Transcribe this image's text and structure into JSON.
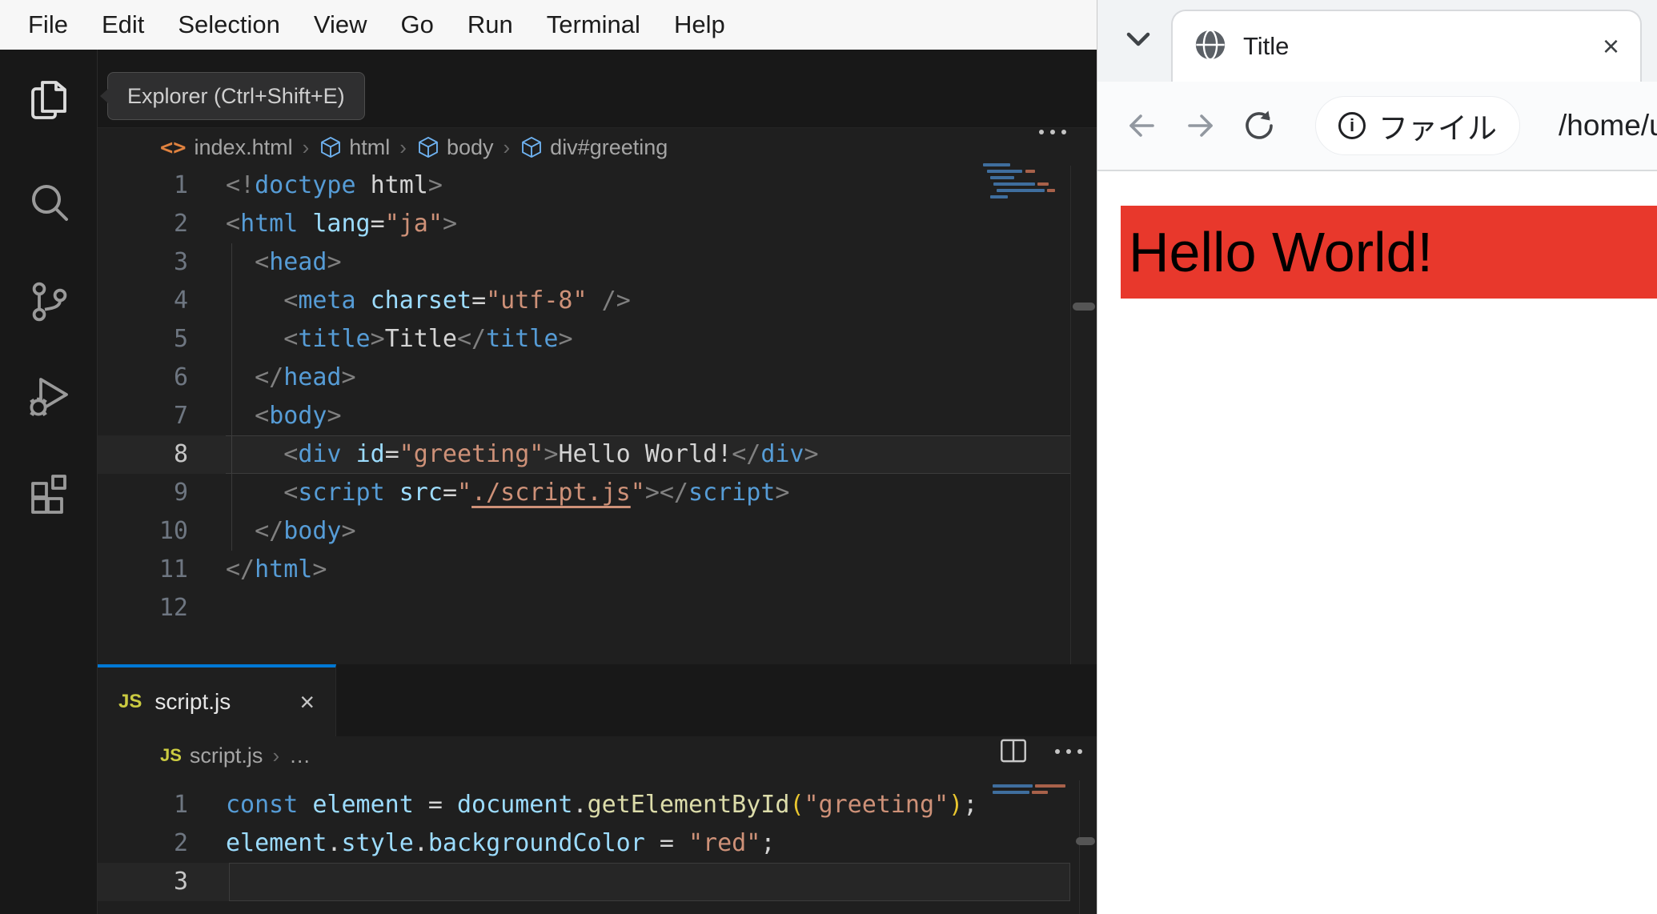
{
  "menu": {
    "items": [
      "File",
      "Edit",
      "Selection",
      "View",
      "Go",
      "Run",
      "Terminal",
      "Help"
    ]
  },
  "activity_bar": {
    "tooltip": "Explorer (Ctrl+Shift+E)",
    "items": [
      "explorer",
      "search",
      "source-control",
      "run-and-debug",
      "extensions"
    ]
  },
  "top_editor": {
    "breadcrumb": {
      "file": "index.html",
      "separator": "›",
      "nodes": [
        "html",
        "body",
        "div#greeting"
      ]
    },
    "active_line": 8,
    "lines": [
      {
        "n": 1,
        "tokens": [
          [
            "<!",
            "punct"
          ],
          [
            "doctype",
            "tag"
          ],
          [
            " html",
            "text"
          ],
          [
            ">",
            "punct"
          ]
        ]
      },
      {
        "n": 2,
        "tokens": [
          [
            "<",
            "punct"
          ],
          [
            "html",
            "tag"
          ],
          [
            " ",
            "text"
          ],
          [
            "lang",
            "attr"
          ],
          [
            "=",
            "text"
          ],
          [
            "\"ja\"",
            "str"
          ],
          [
            ">",
            "punct"
          ]
        ]
      },
      {
        "n": 3,
        "tokens": [
          [
            "  ",
            "text"
          ],
          [
            "<",
            "punct"
          ],
          [
            "head",
            "tag"
          ],
          [
            ">",
            "punct"
          ]
        ]
      },
      {
        "n": 4,
        "tokens": [
          [
            "    ",
            "text"
          ],
          [
            "<",
            "punct"
          ],
          [
            "meta",
            "tag"
          ],
          [
            " ",
            "text"
          ],
          [
            "charset",
            "attr"
          ],
          [
            "=",
            "text"
          ],
          [
            "\"utf-8\"",
            "str"
          ],
          [
            " /",
            "punct"
          ],
          [
            ">",
            "punct"
          ]
        ]
      },
      {
        "n": 5,
        "tokens": [
          [
            "    ",
            "text"
          ],
          [
            "<",
            "punct"
          ],
          [
            "title",
            "tag"
          ],
          [
            ">",
            "punct"
          ],
          [
            "Title",
            "text"
          ],
          [
            "</",
            "punct"
          ],
          [
            "title",
            "tag"
          ],
          [
            ">",
            "punct"
          ]
        ]
      },
      {
        "n": 6,
        "tokens": [
          [
            "  ",
            "text"
          ],
          [
            "</",
            "punct"
          ],
          [
            "head",
            "tag"
          ],
          [
            ">",
            "punct"
          ]
        ]
      },
      {
        "n": 7,
        "tokens": [
          [
            "  ",
            "text"
          ],
          [
            "<",
            "punct"
          ],
          [
            "body",
            "tag"
          ],
          [
            ">",
            "punct"
          ]
        ]
      },
      {
        "n": 8,
        "tokens": [
          [
            "    ",
            "text"
          ],
          [
            "<",
            "punct"
          ],
          [
            "div",
            "tag"
          ],
          [
            " ",
            "text"
          ],
          [
            "id",
            "attr"
          ],
          [
            "=",
            "text"
          ],
          [
            "\"greeting\"",
            "str"
          ],
          [
            ">",
            "punct"
          ],
          [
            "Hello World!",
            "text"
          ],
          [
            "</",
            "punct"
          ],
          [
            "div",
            "tag"
          ],
          [
            ">",
            "punct"
          ]
        ]
      },
      {
        "n": 9,
        "tokens": [
          [
            "    ",
            "text"
          ],
          [
            "<",
            "punct"
          ],
          [
            "script",
            "tag"
          ],
          [
            " ",
            "text"
          ],
          [
            "src",
            "attr"
          ],
          [
            "=",
            "text"
          ],
          [
            "\"",
            "str"
          ],
          [
            "./script.js",
            "link"
          ],
          [
            "\"",
            "str"
          ],
          [
            ">",
            "punct"
          ],
          [
            "</",
            "punct"
          ],
          [
            "script",
            "tag"
          ],
          [
            ">",
            "punct"
          ]
        ]
      },
      {
        "n": 10,
        "tokens": [
          [
            "  ",
            "text"
          ],
          [
            "</",
            "punct"
          ],
          [
            "body",
            "tag"
          ],
          [
            ">",
            "punct"
          ]
        ]
      },
      {
        "n": 11,
        "tokens": [
          [
            "</",
            "punct"
          ],
          [
            "html",
            "tag"
          ],
          [
            ">",
            "punct"
          ]
        ]
      },
      {
        "n": 12,
        "tokens": []
      }
    ]
  },
  "bottom_editor": {
    "tab": {
      "icon": "JS",
      "label": "script.js",
      "close": "×"
    },
    "breadcrumb": {
      "icon": "JS",
      "file": "script.js",
      "separator": "›",
      "rest": "…"
    },
    "active_line": 3,
    "lines": [
      {
        "n": 1,
        "tokens": [
          [
            "const",
            "kw"
          ],
          [
            " ",
            "text"
          ],
          [
            "element",
            "attr"
          ],
          [
            " = ",
            "text"
          ],
          [
            "document",
            "attr"
          ],
          [
            ".",
            "text"
          ],
          [
            "getElementById",
            "func"
          ],
          [
            "(",
            "gold"
          ],
          [
            "\"greeting\"",
            "str"
          ],
          [
            ")",
            "gold"
          ],
          [
            ";",
            "text"
          ]
        ]
      },
      {
        "n": 2,
        "tokens": [
          [
            "element",
            "attr"
          ],
          [
            ".",
            "text"
          ],
          [
            "style",
            "attr"
          ],
          [
            ".",
            "text"
          ],
          [
            "backgroundColor",
            "attr"
          ],
          [
            " = ",
            "text"
          ],
          [
            "\"red\"",
            "str"
          ],
          [
            ";",
            "text"
          ]
        ]
      },
      {
        "n": 3,
        "tokens": []
      }
    ]
  },
  "browser": {
    "tab": {
      "title": "Title",
      "close": "×"
    },
    "toolbar": {
      "chip_icon": "i",
      "chip_label": "ファイル",
      "url": "/home/u"
    },
    "page": {
      "greeting": "Hello World!"
    }
  },
  "colors": {
    "accent_blue": "#0078d4",
    "red_box": "#e8382c",
    "tokens": {
      "punct": "#808080",
      "tag": "#569cd6",
      "attr": "#9cdcfe",
      "str": "#ce9178",
      "text": "#d4d4d4",
      "func": "#dcdcaa",
      "gold": "#e9c62f",
      "kw": "#569cd6",
      "link": "#ce9178"
    }
  }
}
